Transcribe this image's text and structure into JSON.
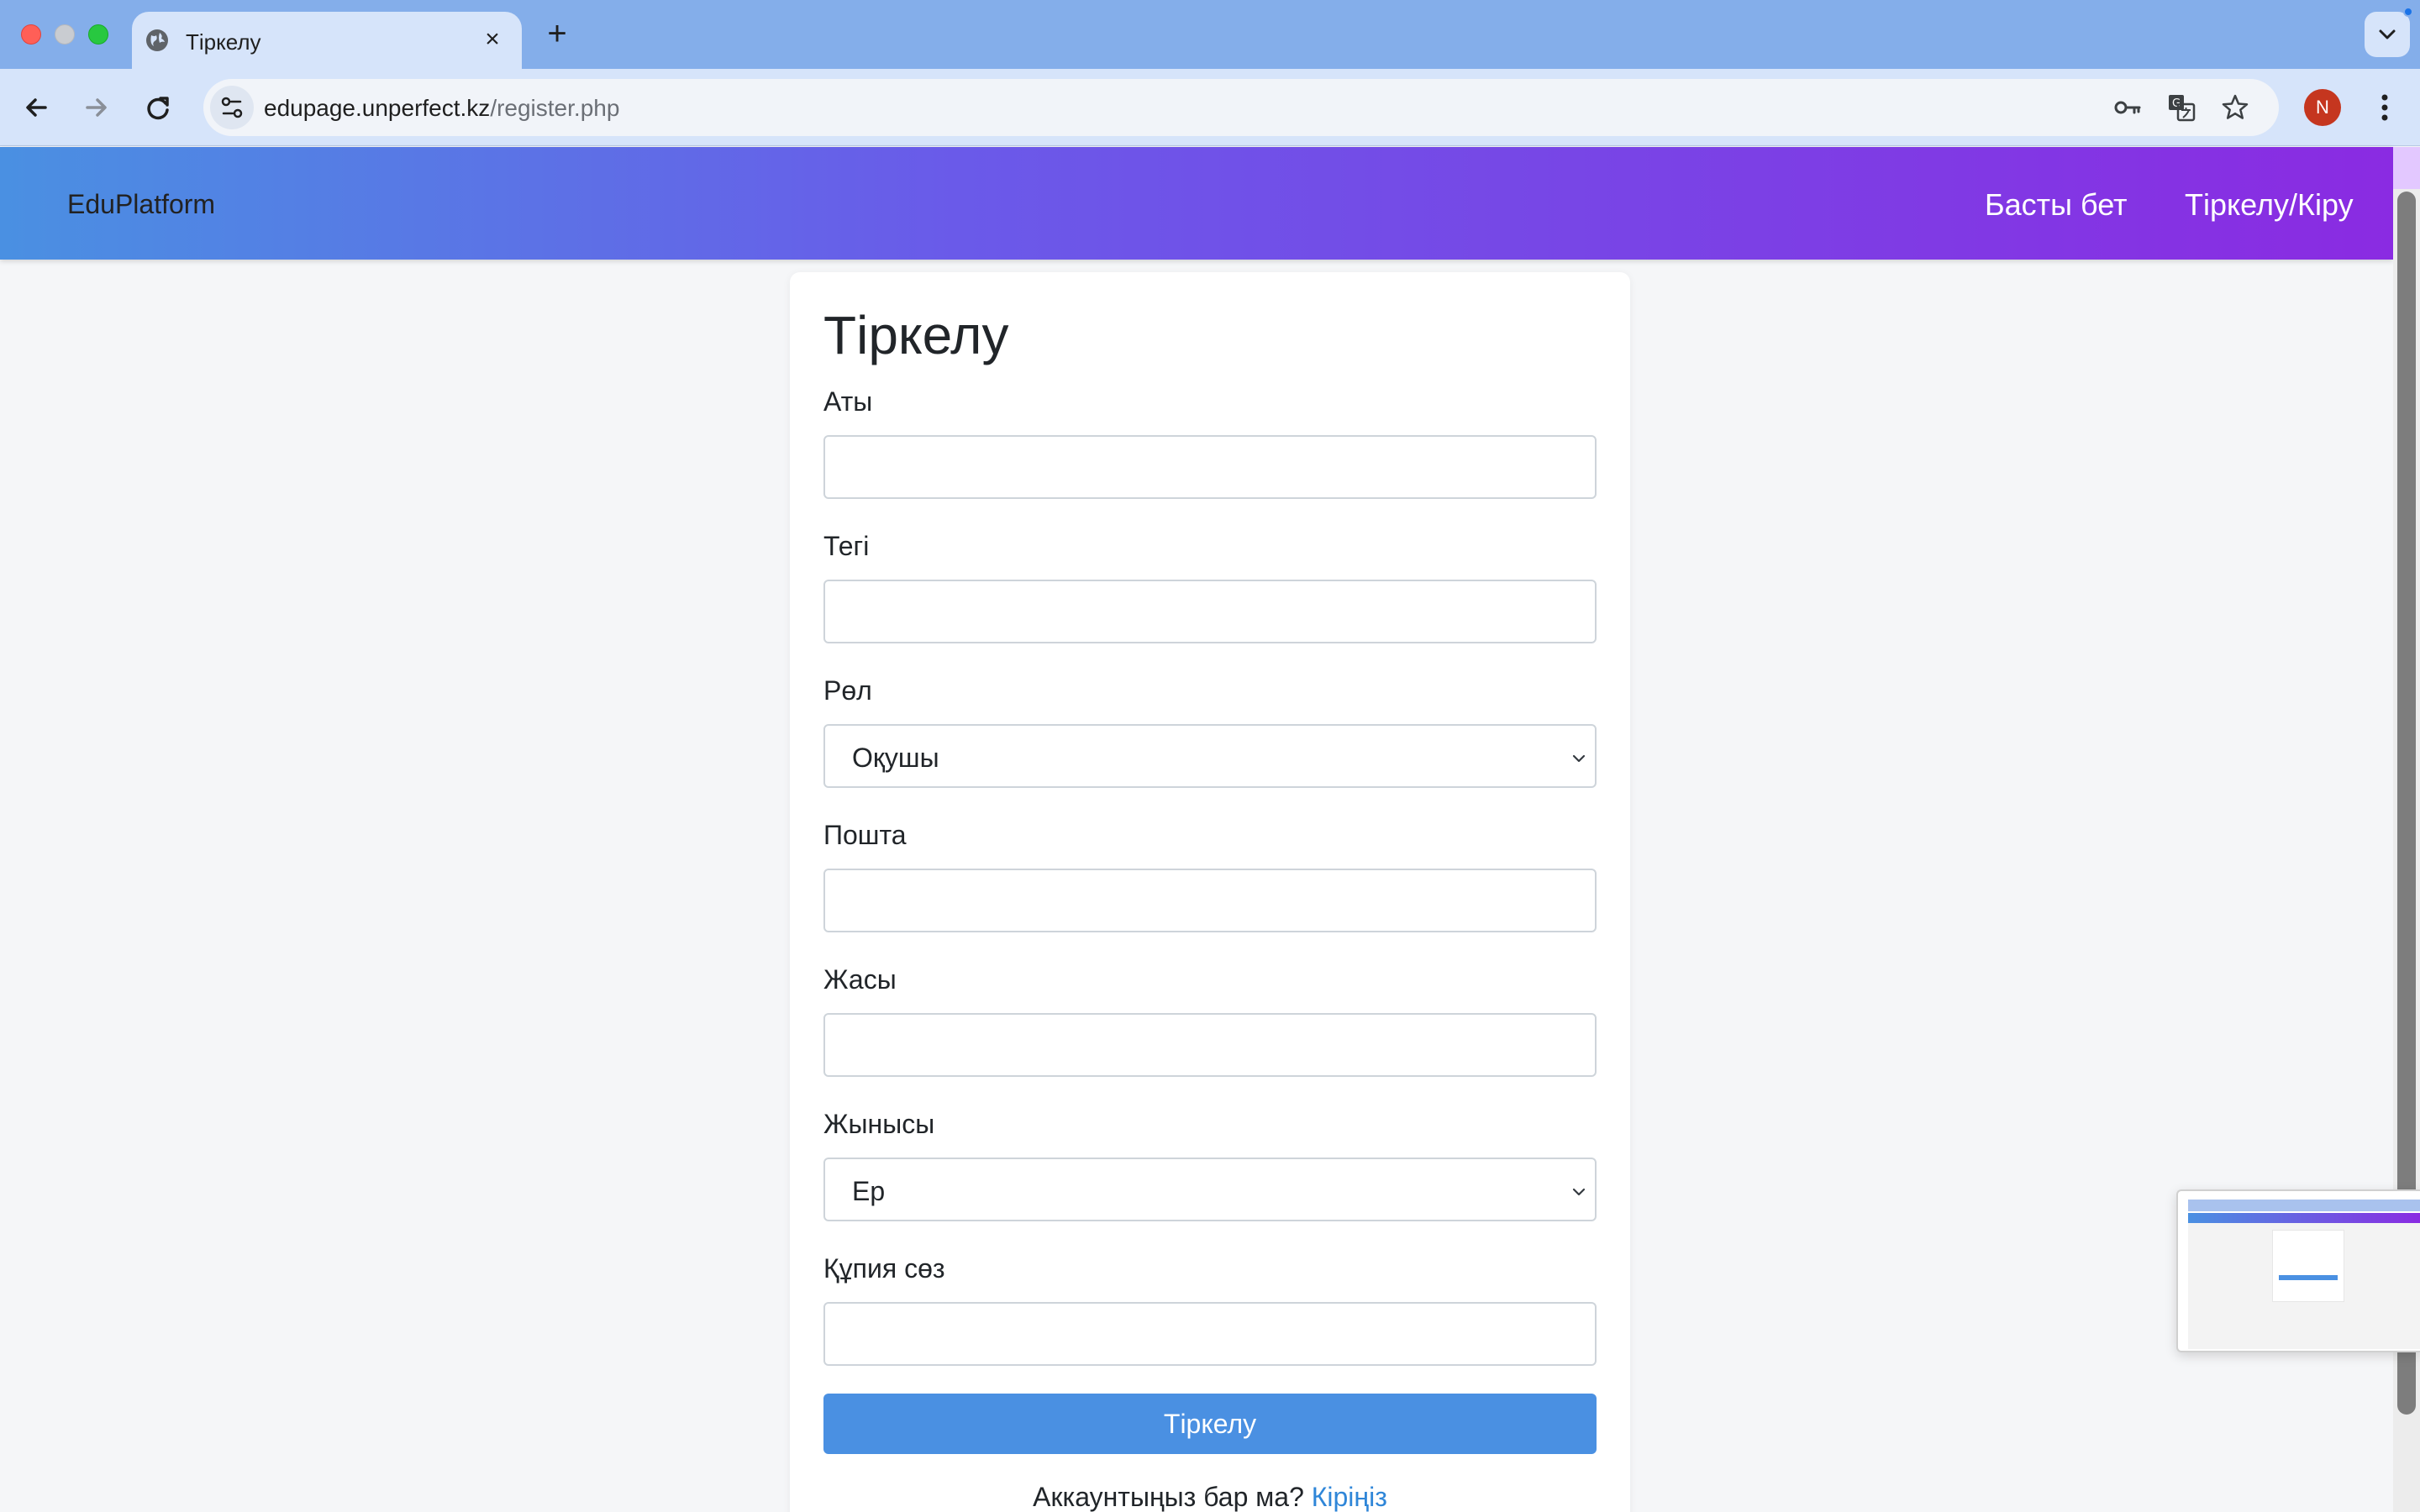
{
  "browser": {
    "tab_title": "Тіркелу",
    "url_host": "edupage.unperfect.kz",
    "url_path": "/register.php",
    "profile_initial": "N",
    "icons": [
      "globe-icon",
      "close-icon",
      "plus-icon",
      "back-icon",
      "forward-icon",
      "reload-icon",
      "site-settings-icon",
      "key-icon",
      "translate-icon",
      "star-icon",
      "kebab-menu-icon",
      "chevron-down-icon"
    ]
  },
  "navbar": {
    "brand": "EduPlatform",
    "links": [
      "Басты бет",
      "Тіркелу/Кіру"
    ]
  },
  "form": {
    "title": "Тіркелу",
    "fields": {
      "first_name": {
        "label": "Аты",
        "value": ""
      },
      "last_name": {
        "label": "Тегі",
        "value": ""
      },
      "role": {
        "label": "Рөл",
        "value": "Оқушы"
      },
      "email": {
        "label": "Пошта",
        "value": ""
      },
      "age": {
        "label": "Жасы",
        "value": ""
      },
      "gender": {
        "label": "Жынысы",
        "value": "Ер"
      },
      "password": {
        "label": "Құпия сөз",
        "value": ""
      }
    },
    "submit_label": "Тіркелу",
    "footer_text": "Аккаунтыңыз бар ма?",
    "login_link": "Кіріңіз"
  },
  "colors": {
    "navbar_gradient_start": "#4a90e2",
    "navbar_gradient_end": "#8a2be2",
    "primary_button": "#4a90e2",
    "link": "#2f86d8"
  }
}
